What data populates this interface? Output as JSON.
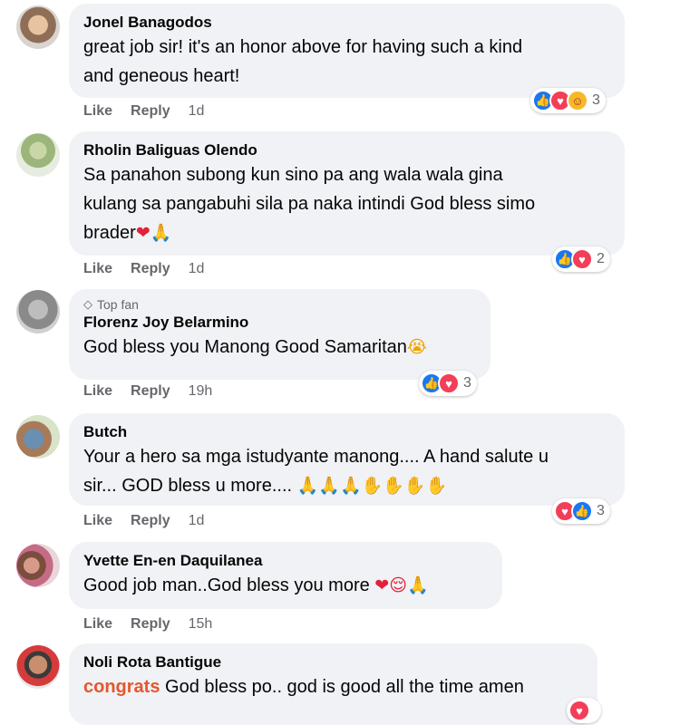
{
  "comments": [
    {
      "name": "Jonel Banagodos",
      "text_line1": "great job sir! it's an honor above for having such a kind",
      "text_line2": "and geneous heart!",
      "like": "Like",
      "reply": "Reply",
      "time": "1d",
      "reaction_count": "3",
      "reactions": [
        "like",
        "love",
        "care"
      ]
    },
    {
      "name": "Rholin Baliguas Olendo",
      "text_line1": "Sa panahon subong kun sino pa ang wala wala gina",
      "text_line2": "kulang sa pangabuhi sila pa naka intindi God bless simo",
      "text_line3": "brader",
      "emojis": "❤🙏",
      "like": "Like",
      "reply": "Reply",
      "time": "1d",
      "reaction_count": "2",
      "reactions": [
        "like",
        "love"
      ]
    },
    {
      "badge": "Top fan",
      "name": "Florenz Joy Belarmino",
      "text_line1": "God bless you Manong Good Samaritan",
      "emojis": "😭",
      "like": "Like",
      "reply": "Reply",
      "time": "19h",
      "reaction_count": "3",
      "reactions": [
        "like",
        "love"
      ]
    },
    {
      "name": "Butch",
      "text_line1": "Your a hero sa mga istudyante manong.... A hand salute u",
      "text_line2": "sir... GOD bless u more....",
      "emojis": "🙏🙏🙏✋✋✋✋",
      "like": "Like",
      "reply": "Reply",
      "time": "1d",
      "reaction_count": "3",
      "reactions": [
        "love",
        "like"
      ]
    },
    {
      "name": "Yvette En-en Daquilanea",
      "text_line1": "Good job man..God bless you more",
      "emojis": "❤😌🙏",
      "like": "Like",
      "reply": "Reply",
      "time": "15h"
    },
    {
      "name": "Noli Rota Bantigue",
      "highlight": "congrats",
      "text_line1": "God bless po.. god is good all the time amen"
    }
  ]
}
